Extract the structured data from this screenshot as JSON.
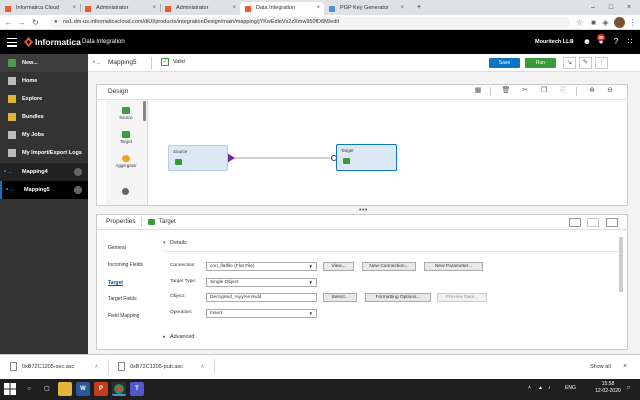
{
  "browser": {
    "tabs": [
      {
        "label": "Informatica Cloud",
        "favicon_color": "#f15a24"
      },
      {
        "label": "Administrator",
        "favicon_color": "#f15a24"
      },
      {
        "label": "Administrator",
        "favicon_color": "#f15a24"
      },
      {
        "label": "Data Integration",
        "favicon_color": "#f15a24"
      },
      {
        "label": "PGP Key Generator",
        "favicon_color": "#4a90d9"
      }
    ],
    "active_tab_index": 3,
    "new_tab": "+",
    "close": "×",
    "url": "na1.dm-us.informaticacloud.com/diUI/products/integrationDesign/main/mapping/jYKwEdleVs2zXmw950fD8M/edit"
  },
  "header": {
    "brand": "Informatica",
    "product": "Data Integration",
    "org": "Mouritech LLC",
    "notification_count": "30",
    "accent": "#f15a24"
  },
  "sidebar": {
    "items": [
      {
        "label": "New...",
        "icon": "plus-icon"
      },
      {
        "label": "Home",
        "icon": "home-icon"
      },
      {
        "label": "Explore",
        "icon": "folder-icon"
      },
      {
        "label": "Bundles",
        "icon": "bundle-icon"
      },
      {
        "label": "My Jobs",
        "icon": "jobs-icon"
      },
      {
        "label": "My Import/Export Logs",
        "icon": "logs-icon"
      }
    ],
    "open_items": [
      {
        "label": "Mapping4"
      },
      {
        "label": "Mapping5"
      }
    ]
  },
  "toolbar": {
    "title": "Mapping5",
    "status": "Valid",
    "save_label": "Save",
    "run_label": "Run"
  },
  "design": {
    "title": "Design",
    "palette": [
      {
        "label": "Source",
        "color": "#3a9b3a"
      },
      {
        "label": "Target",
        "color": "#3a9b3a"
      },
      {
        "label": "Aggregator",
        "color": "#f0a020"
      }
    ],
    "nodes": [
      {
        "label": "Source"
      },
      {
        "label": "Target"
      }
    ]
  },
  "properties": {
    "title": "Properties",
    "object": "Target",
    "tabs": [
      "General",
      "Incoming Fields",
      "Target",
      "Target Fields",
      "Field Mapping"
    ],
    "active_tab_index": 2,
    "details_label": "Details",
    "advanced_label": "Advanced",
    "fields": {
      "connection": {
        "label": "Connection:",
        "value": "con_flatfile (Flat File)"
      },
      "target_type": {
        "label": "Target Type:",
        "value": "Single Object"
      },
      "object": {
        "label": "Object:",
        "value": "Decrypted_%yy%m%dd"
      },
      "operation": {
        "label": "Operation:",
        "value": "Insert"
      }
    },
    "buttons": {
      "view": "View...",
      "new_connection": "New Connection...",
      "new_parameter": "New Parameter...",
      "select": "Select...",
      "formatting_options": "Formatting Options...",
      "preview_data": "Preview Data..."
    }
  },
  "downloads": {
    "items": [
      "0xB72C1205-sec.asc",
      "0xB72C1205-pub.asc"
    ],
    "show_all": "Show all"
  },
  "taskbar": {
    "language": "ENG",
    "time": "15:58",
    "date": "12-02-2020"
  }
}
